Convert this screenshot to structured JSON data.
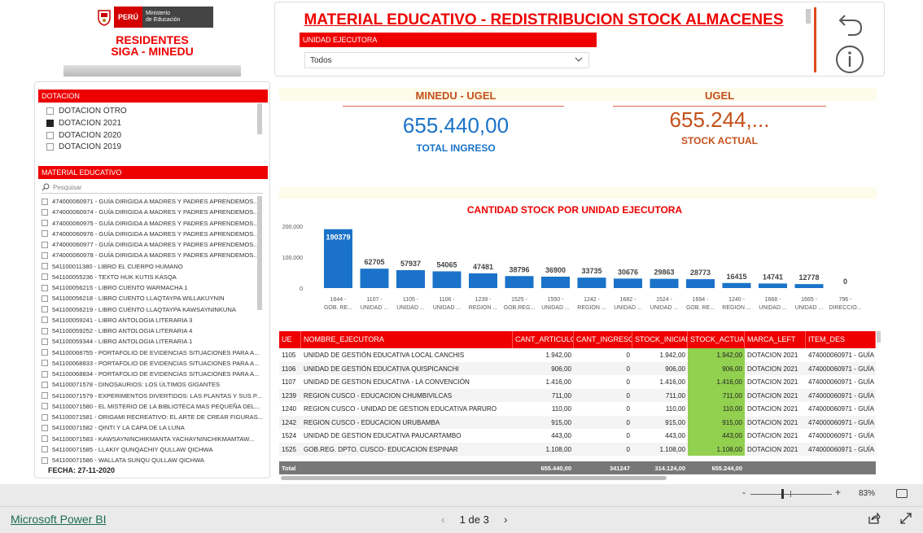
{
  "logo": {
    "peru": "PERÚ",
    "ministerio": "Ministerio",
    "educacion": "de Educación",
    "line1": "RESIDENTES",
    "line2": "SIGA - MINEDU"
  },
  "header": {
    "title": "MATERIAL EDUCATIVO - REDISTRIBUCION STOCK ALMACENES",
    "ue_label": "UNIDAD EJECUTORA",
    "ue_value": "Todos"
  },
  "dotacion": {
    "label": "DOTACION",
    "items": [
      {
        "label": "DOTACION OTRO",
        "checked": false
      },
      {
        "label": "DOTACION 2021",
        "checked": true
      },
      {
        "label": "DOTACION 2020",
        "checked": false
      },
      {
        "label": "DOTACION 2019",
        "checked": false
      }
    ]
  },
  "material": {
    "label": "MATERIAL EDUCATIVO",
    "search_placeholder": "Pesquisar",
    "items": [
      "474000060971 - GUÍA DIRIGIDA A MADRES Y PADRES APRENDEMOS...",
      "474000060974 - GUÍA DIRIGIDA A MADRES Y PADRES APRENDEMOS...",
      "474000060975 - GUÍA DIRIGIDA A MADRES Y PADRES APRENDEMOS...",
      "474000060976 - GUÍA DIRIGIDA A MADRES Y PADRES APRENDEMOS...",
      "474000060977 - GUÍA DIRIGIDA A MADRES Y PADRES APRENDEMOS...",
      "474000060978 - GUÍA DIRIGIDA A MADRES Y PADRES APRENDEMOS...",
      "541100011380 - LIBRO EL CUERPO HUMANO",
      "541100055236 - TEXTO HUK KUTIS KASQA",
      "541100056215 - LIBRO CUENTO WARMACHA 1",
      "541100056218 - LIBRO CUENTO LLAQTAYPA WILLAKUYNIN",
      "541100056219 - LIBRO CUENTO LLAQTAYPA KAWSAYNINKUNA",
      "541100059241 - LIBRO ANTOLOGIA LITERARIA 3",
      "541100059252 - LIBRO ANTOLOGIA LITERARIA 4",
      "541100059344 - LIBRO ANTOLOGIA LITERARIA 1",
      "541100068755 - PORTAFOLIO DE EVIDENCIAS SITUACIONES PARA A...",
      "541100068833 - PORTAFOLIO DE EVIDENCIAS SITUACIONES PARA A...",
      "541100068834 - PORTAFOLIO DE EVIDENCIAS SITUACIONES PARA A...",
      "541100071578 - DINOSAURIOS: LOS ÚLTIMOS GIGANTES",
      "541100071579 - EXPERIMENTOS DIVERTIDOS: LAS PLANTAS Y SUS P...",
      "541100071580 - EL MISTERIO DE LA BIBLIOTECA MAS PEQUEÑA DEL...",
      "541100071581 - ORIGAMI RECREATIVO: EL ARTE DE CREAR FIGURAS...",
      "541100071582 - QINTI Y LA CAPA DE LA LUNA",
      "541100071583 - KAWSAYNINCHIKMANTA YACHAYNINCHIKMAMTAW...",
      "541100071585 - LLAKIY QUNQACHIY QULLAW QICHWA",
      "541100071586 - WALLATA SUNQU QULLAW QICHWA"
    ]
  },
  "fecha": "FECHA:  27-11-2020",
  "kpi": {
    "left_title": "MINEDU - UGEL",
    "left_value": "655.440,00",
    "left_sub": "TOTAL INGRESO",
    "right_title": "UGEL",
    "right_value": "655.244,...",
    "right_sub": "STOCK ACTUAL",
    "blue": "#1a73c8",
    "orange": "#c4501a"
  },
  "chart_data": {
    "type": "bar",
    "title": "CANTIDAD STOCK POR UNIDAD EJECUTORA",
    "categories": [
      [
        "1644 -",
        "GOB. RE..."
      ],
      [
        "1107 -",
        "UNIDAD ..."
      ],
      [
        "1105 -",
        "UNIDAD ..."
      ],
      [
        "1106 -",
        "UNIDAD ..."
      ],
      [
        "1239 -",
        "REGION ..."
      ],
      [
        "1525 -",
        "GOB.REG..."
      ],
      [
        "1550 -",
        "UNIDAD ..."
      ],
      [
        "1242 -",
        "REGION ..."
      ],
      [
        "1682 -",
        "UNIDAD ..."
      ],
      [
        "1524 -",
        "UNIDAD ..."
      ],
      [
        "1694 -",
        "GOB. RE..."
      ],
      [
        "1240 -",
        "REGION ..."
      ],
      [
        "1668 -",
        "UNIDAD ..."
      ],
      [
        "1665 -",
        "UNIDAD ..."
      ],
      [
        "796 -",
        "DIRECCIO..."
      ]
    ],
    "values": [
      190379,
      62705,
      57937,
      54065,
      47481,
      38796,
      36900,
      33735,
      30676,
      29863,
      28773,
      16415,
      14741,
      12778,
      0
    ],
    "yticks": [
      "200.000",
      "100.000",
      "0"
    ],
    "ylim": [
      0,
      200000
    ],
    "color": "#1a73c8"
  },
  "table": {
    "columns": [
      "UE",
      "NOMBRE_EJECUTORA",
      "CANT_ARTICULO",
      "CANT_INGRESO",
      "STOCK_INICIAL",
      "STOCK_ACTUAL",
      "MARCA_LEFT",
      "ITEM_DES"
    ],
    "rows": [
      [
        "1105",
        "UNIDAD DE GESTIÓN EDUCATIVA LOCAL CANCHIS",
        "1.942,00",
        "0",
        "1.942,00",
        "1.942,00",
        "DOTACION 2021",
        "474000060971 - GUÍA"
      ],
      [
        "1106",
        "UNIDAD DE GESTIÓN EDUCATIVA QUISPICANCHI",
        "906,00",
        "0",
        "906,00",
        "906,00",
        "DOTACION 2021",
        "474000060971 - GUÍA"
      ],
      [
        "1107",
        "UNIDAD DE GESTION EDUCATIVA - LA CONVENCIÓN",
        "1.416,00",
        "0",
        "1.416,00",
        "1.416,00",
        "DOTACION 2021",
        "474000060971 - GUÍA"
      ],
      [
        "1239",
        "REGION CUSCO - EDUCACION CHUMBIVILCAS",
        "711,00",
        "0",
        "711,00",
        "711,00",
        "DOTACION 2021",
        "474000060971 - GUÍA"
      ],
      [
        "1240",
        "REGION CUSCO - UNIDAD DE GESTION EDUCATIVA PARURO",
        "110,00",
        "0",
        "110,00",
        "110,00",
        "DOTACION 2021",
        "474000060971 - GUÍA"
      ],
      [
        "1242",
        "REGION CUSCO - EDUCACION URUBAMBA",
        "915,00",
        "0",
        "915,00",
        "915,00",
        "DOTACION 2021",
        "474000060971 - GUÍA"
      ],
      [
        "1524",
        "UNIDAD DE GESTION EDUCATIVA PAUCARTAMBO",
        "443,00",
        "0",
        "443,00",
        "443,00",
        "DOTACION 2021",
        "474000060971 - GUÍA"
      ],
      [
        "1525",
        "GOB.REG. DPTO. CUSCO- EDUCACION ESPINAR",
        "1.108,00",
        "0",
        "1.108,00",
        "1.108,00",
        "DOTACION 2021",
        "474000060971 - GUÍA"
      ]
    ],
    "total": {
      "label": "Total",
      "cant_articulo": "655.440,00",
      "cant_ingreso": "341247",
      "stock_inicial": "314.124,00",
      "stock_actual": "655.244,00"
    }
  },
  "zoom": {
    "minus": "-",
    "plus": "+",
    "pct": "83%"
  },
  "footer": {
    "brand": "Microsoft Power BI",
    "page": "1 de 3",
    "prev": "‹",
    "next": "›"
  }
}
